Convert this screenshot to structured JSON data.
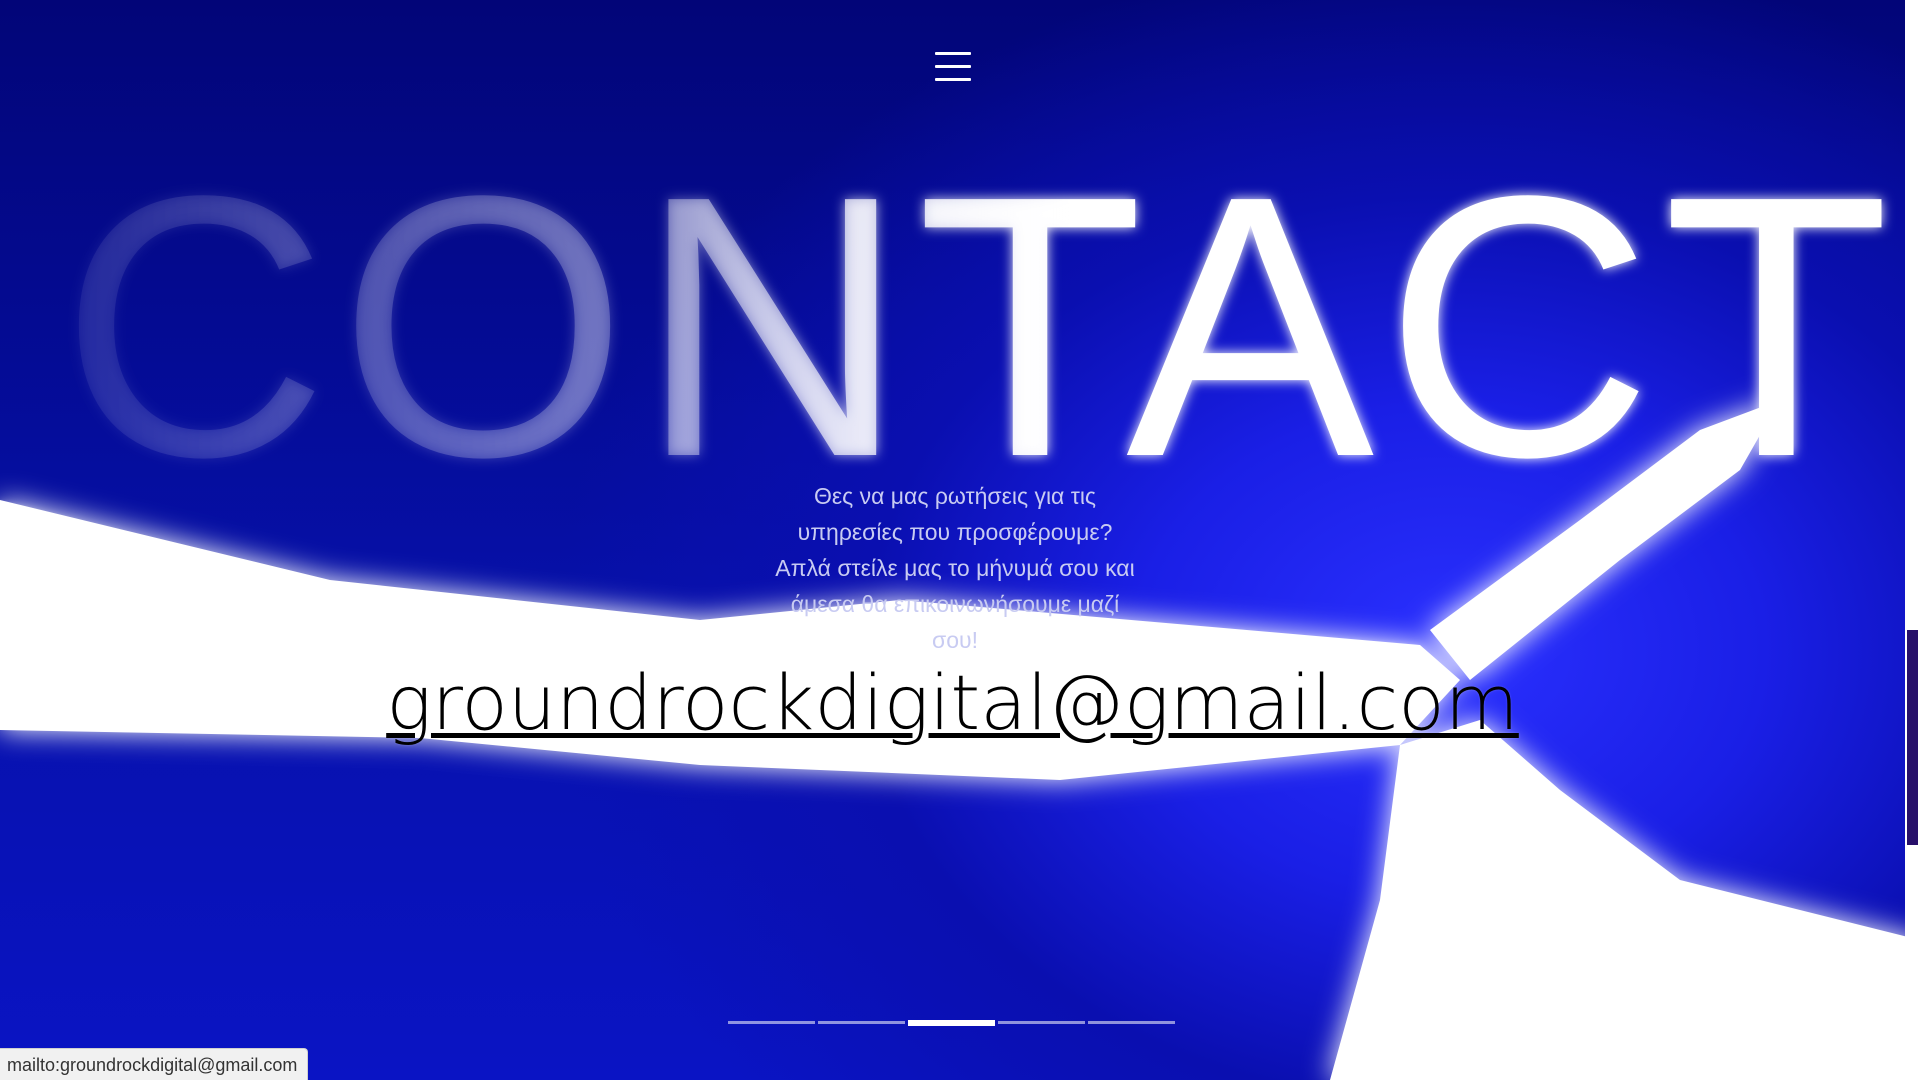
{
  "nav": {
    "menu_icon": "hamburger-menu-icon"
  },
  "hero": {
    "heading": "CONTACT",
    "intro_lines": [
      "Θες να μας ρωτήσεις για τις",
      "υπηρεσίες που προσφέρουμε?",
      "Απλά στείλε μας το μήνυμά σου και",
      "άμεσα θα επικοινωνήσουμε μαζί",
      "σου!"
    ],
    "email": "groundrockdigital@gmail.com"
  },
  "pager": {
    "slides": 5,
    "active_index": 2
  },
  "status_bar": {
    "url": "mailto:groundrockdigital@gmail.com"
  },
  "colors": {
    "background": "#05087f",
    "glow": "#2a30ff",
    "beam": "#ffffff",
    "text_light": "#c8cbf2",
    "email_text": "#000000"
  }
}
